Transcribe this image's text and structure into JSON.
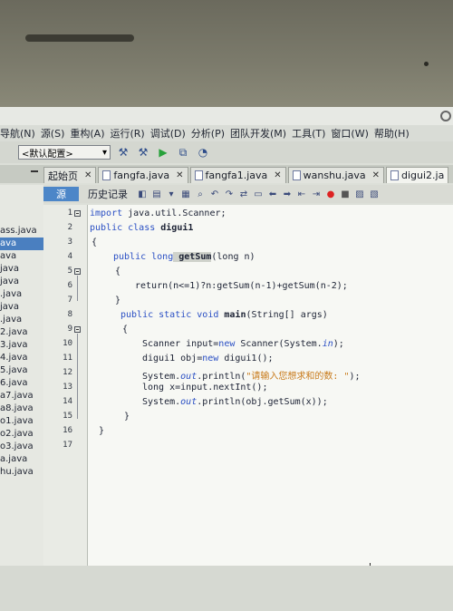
{
  "menu": [
    "导航(N)",
    "源(S)",
    "重构(A)",
    "运行(R)",
    "调试(D)",
    "分析(P)",
    "团队开发(M)",
    "工具(T)",
    "窗口(W)",
    "帮助(H)"
  ],
  "toolbar": {
    "config_value": "<默认配置>"
  },
  "tabs": [
    {
      "label": "起始页"
    },
    {
      "label": "fangfa.java"
    },
    {
      "label": "fangfa1.java"
    },
    {
      "label": "wanshu.java"
    },
    {
      "label": "digui2.ja"
    }
  ],
  "subtabs": {
    "source": "源",
    "history": "历史记录"
  },
  "project_files": [
    "ass.java",
    "ava",
    "ava",
    "java",
    "java",
    ".java",
    "java",
    ".java",
    "2.java",
    "3.java",
    "4.java",
    "5.java",
    "6.java",
    "a7.java",
    "a8.java",
    "o1.java",
    "o2.java",
    "o3.java",
    "a.java",
    "hu.java"
  ],
  "line_numbers": [
    "1",
    "2",
    "3",
    "4",
    "5",
    "6",
    "7",
    "8",
    "9",
    "10",
    "11",
    "12",
    "13",
    "14",
    "15",
    "16",
    "17"
  ],
  "code": {
    "l1_kw": "import",
    "l1_rest": " java.util.Scanner;",
    "l2_kw": "public class",
    "l2_name": " digui1",
    "l3": "{",
    "l4_kw": "public long",
    "l4_name": " getSum",
    "l4_rest": "(long n)",
    "l5": "{",
    "l6": "return(n<=1)?n:getSum(n-1)+getSum(n-2);",
    "l7": "}",
    "l8_kw": "public static void",
    "l8_name": " main",
    "l8_rest": "(String[] args)",
    "l9": "{",
    "l10_a": "Scanner input=",
    "l10_kw": "new",
    "l10_b": " Scanner(System.",
    "l10_in": "in",
    "l10_c": ");",
    "l11_a": "digui1 obj=",
    "l11_kw": "new",
    "l11_b": " digui1();",
    "l12_a": "System.",
    "l12_out": "out",
    "l12_b": ".println(",
    "l12_str": "\"请输入您想求和的数: \"",
    "l12_c": ");",
    "l13": "long x=input.nextInt();",
    "l14_a": "System.",
    "l14_out": "out",
    "l14_b": ".println(obj.getSum(x));",
    "l15": "}",
    "l16": "}"
  },
  "colors": {
    "keyword": "#2a4fc4",
    "string": "#c87a1a",
    "selection": "#4a7fc0"
  }
}
